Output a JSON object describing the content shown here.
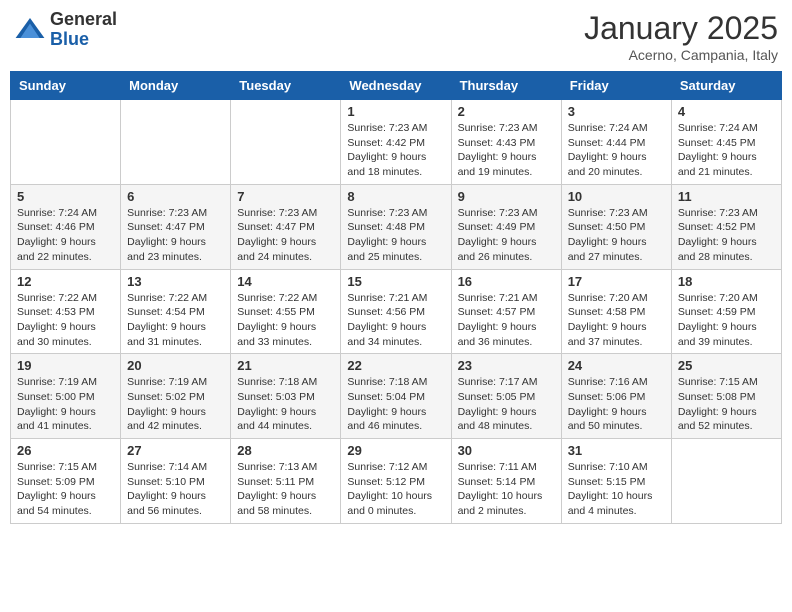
{
  "header": {
    "logo_general": "General",
    "logo_blue": "Blue",
    "month_title": "January 2025",
    "location": "Acerno, Campania, Italy"
  },
  "days_of_week": [
    "Sunday",
    "Monday",
    "Tuesday",
    "Wednesday",
    "Thursday",
    "Friday",
    "Saturday"
  ],
  "weeks": [
    [
      {
        "day": "",
        "info": ""
      },
      {
        "day": "",
        "info": ""
      },
      {
        "day": "",
        "info": ""
      },
      {
        "day": "1",
        "info": "Sunrise: 7:23 AM\nSunset: 4:42 PM\nDaylight: 9 hours\nand 18 minutes."
      },
      {
        "day": "2",
        "info": "Sunrise: 7:23 AM\nSunset: 4:43 PM\nDaylight: 9 hours\nand 19 minutes."
      },
      {
        "day": "3",
        "info": "Sunrise: 7:24 AM\nSunset: 4:44 PM\nDaylight: 9 hours\nand 20 minutes."
      },
      {
        "day": "4",
        "info": "Sunrise: 7:24 AM\nSunset: 4:45 PM\nDaylight: 9 hours\nand 21 minutes."
      }
    ],
    [
      {
        "day": "5",
        "info": "Sunrise: 7:24 AM\nSunset: 4:46 PM\nDaylight: 9 hours\nand 22 minutes."
      },
      {
        "day": "6",
        "info": "Sunrise: 7:23 AM\nSunset: 4:47 PM\nDaylight: 9 hours\nand 23 minutes."
      },
      {
        "day": "7",
        "info": "Sunrise: 7:23 AM\nSunset: 4:47 PM\nDaylight: 9 hours\nand 24 minutes."
      },
      {
        "day": "8",
        "info": "Sunrise: 7:23 AM\nSunset: 4:48 PM\nDaylight: 9 hours\nand 25 minutes."
      },
      {
        "day": "9",
        "info": "Sunrise: 7:23 AM\nSunset: 4:49 PM\nDaylight: 9 hours\nand 26 minutes."
      },
      {
        "day": "10",
        "info": "Sunrise: 7:23 AM\nSunset: 4:50 PM\nDaylight: 9 hours\nand 27 minutes."
      },
      {
        "day": "11",
        "info": "Sunrise: 7:23 AM\nSunset: 4:52 PM\nDaylight: 9 hours\nand 28 minutes."
      }
    ],
    [
      {
        "day": "12",
        "info": "Sunrise: 7:22 AM\nSunset: 4:53 PM\nDaylight: 9 hours\nand 30 minutes."
      },
      {
        "day": "13",
        "info": "Sunrise: 7:22 AM\nSunset: 4:54 PM\nDaylight: 9 hours\nand 31 minutes."
      },
      {
        "day": "14",
        "info": "Sunrise: 7:22 AM\nSunset: 4:55 PM\nDaylight: 9 hours\nand 33 minutes."
      },
      {
        "day": "15",
        "info": "Sunrise: 7:21 AM\nSunset: 4:56 PM\nDaylight: 9 hours\nand 34 minutes."
      },
      {
        "day": "16",
        "info": "Sunrise: 7:21 AM\nSunset: 4:57 PM\nDaylight: 9 hours\nand 36 minutes."
      },
      {
        "day": "17",
        "info": "Sunrise: 7:20 AM\nSunset: 4:58 PM\nDaylight: 9 hours\nand 37 minutes."
      },
      {
        "day": "18",
        "info": "Sunrise: 7:20 AM\nSunset: 4:59 PM\nDaylight: 9 hours\nand 39 minutes."
      }
    ],
    [
      {
        "day": "19",
        "info": "Sunrise: 7:19 AM\nSunset: 5:00 PM\nDaylight: 9 hours\nand 41 minutes."
      },
      {
        "day": "20",
        "info": "Sunrise: 7:19 AM\nSunset: 5:02 PM\nDaylight: 9 hours\nand 42 minutes."
      },
      {
        "day": "21",
        "info": "Sunrise: 7:18 AM\nSunset: 5:03 PM\nDaylight: 9 hours\nand 44 minutes."
      },
      {
        "day": "22",
        "info": "Sunrise: 7:18 AM\nSunset: 5:04 PM\nDaylight: 9 hours\nand 46 minutes."
      },
      {
        "day": "23",
        "info": "Sunrise: 7:17 AM\nSunset: 5:05 PM\nDaylight: 9 hours\nand 48 minutes."
      },
      {
        "day": "24",
        "info": "Sunrise: 7:16 AM\nSunset: 5:06 PM\nDaylight: 9 hours\nand 50 minutes."
      },
      {
        "day": "25",
        "info": "Sunrise: 7:15 AM\nSunset: 5:08 PM\nDaylight: 9 hours\nand 52 minutes."
      }
    ],
    [
      {
        "day": "26",
        "info": "Sunrise: 7:15 AM\nSunset: 5:09 PM\nDaylight: 9 hours\nand 54 minutes."
      },
      {
        "day": "27",
        "info": "Sunrise: 7:14 AM\nSunset: 5:10 PM\nDaylight: 9 hours\nand 56 minutes."
      },
      {
        "day": "28",
        "info": "Sunrise: 7:13 AM\nSunset: 5:11 PM\nDaylight: 9 hours\nand 58 minutes."
      },
      {
        "day": "29",
        "info": "Sunrise: 7:12 AM\nSunset: 5:12 PM\nDaylight: 10 hours\nand 0 minutes."
      },
      {
        "day": "30",
        "info": "Sunrise: 7:11 AM\nSunset: 5:14 PM\nDaylight: 10 hours\nand 2 minutes."
      },
      {
        "day": "31",
        "info": "Sunrise: 7:10 AM\nSunset: 5:15 PM\nDaylight: 10 hours\nand 4 minutes."
      },
      {
        "day": "",
        "info": ""
      }
    ]
  ]
}
